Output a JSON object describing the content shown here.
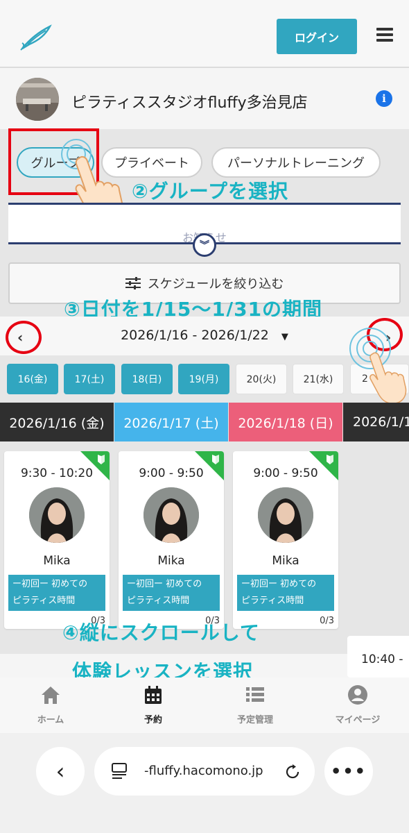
{
  "header": {
    "login_label": "ログイン"
  },
  "studio": {
    "name": "ピラティススタジオfluffy多治見店",
    "info_glyph": "i"
  },
  "lesson_types": [
    {
      "label": "グループ",
      "selected": true
    },
    {
      "label": "プライベート",
      "selected": false
    },
    {
      "label": "パーソナルトレーニング",
      "selected": false
    }
  ],
  "annotations": {
    "step2": "②グループを選択",
    "step3": "③日付を1/15〜1/31の期間",
    "step4_line1": "④縦にスクロールして",
    "step4_line2": "体験レッスンを選択"
  },
  "notice": {
    "label": "お知らせ"
  },
  "filter": {
    "label": "スケジュールを絞り込む"
  },
  "date_nav": {
    "range": "2026/1/16 - 2026/1/22",
    "caret": "▼",
    "prev": "‹",
    "next": "›"
  },
  "day_pills": [
    {
      "label": "16(金)",
      "active": true
    },
    {
      "label": "17(土)",
      "active": true
    },
    {
      "label": "18(日)",
      "active": true
    },
    {
      "label": "19(月)",
      "active": true
    },
    {
      "label": "20(火)",
      "active": false
    },
    {
      "label": "21(水)",
      "active": false
    },
    {
      "label": "2",
      "active": false
    }
  ],
  "date_headers": [
    {
      "label": "2026/1/16 (金)",
      "color": "#2f2f2f"
    },
    {
      "label": "2026/1/17 (土)",
      "color": "#45b4eb"
    },
    {
      "label": "2026/1/18 (日)",
      "color": "#ec5f7a"
    },
    {
      "label": "2026/1/1",
      "color": "#2f2f2f"
    }
  ],
  "lessons": [
    {
      "time": "9:30 - 10:20",
      "instructor": "Mika",
      "title_line1": "ー初回ー 初めての",
      "title_line2": "ピラティス時間",
      "count": "0/3"
    },
    {
      "time": "9:00 - 9:50",
      "instructor": "Mika",
      "title_line1": "ー初回ー 初めての",
      "title_line2": "ピラティス時間",
      "count": "0/3"
    },
    {
      "time": "9:00 - 9:50",
      "instructor": "Mika",
      "title_line1": "ー初回ー 初めての",
      "title_line2": "ピラティス時間",
      "count": "0/3"
    }
  ],
  "partial_lesson": {
    "time": "10:40 -"
  },
  "tabbar": [
    {
      "label": "ホーム",
      "icon": "home-icon",
      "active": false
    },
    {
      "label": "予約",
      "icon": "calendar-icon",
      "active": true
    },
    {
      "label": "予定管理",
      "icon": "list-icon",
      "active": false
    },
    {
      "label": "マイページ",
      "icon": "user-icon",
      "active": false
    }
  ],
  "browser": {
    "url": "-fluffy.hacomono.jp",
    "back_glyph": "‹",
    "more_glyph": "•••"
  },
  "colors": {
    "accent": "#31a6c0",
    "annotation": "#19b3c3",
    "highlight": "#e60012",
    "beginner_badge": "#2fb548"
  }
}
